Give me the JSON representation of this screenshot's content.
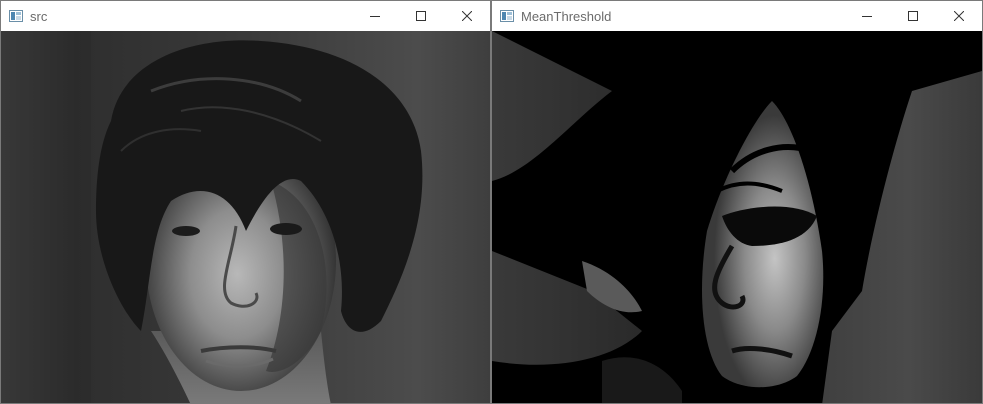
{
  "windows": [
    {
      "title": "src",
      "icon": "opencv-window-icon",
      "controls": {
        "minimize": "minimize-icon",
        "maximize": "maximize-icon",
        "close": "close-icon"
      },
      "image": {
        "description_icon": "portrait-photo",
        "mode": "grayscale"
      }
    },
    {
      "title": "MeanThreshold",
      "icon": "opencv-window-icon",
      "controls": {
        "minimize": "minimize-icon",
        "maximize": "maximize-icon",
        "close": "close-icon"
      },
      "image": {
        "description_icon": "portrait-photo",
        "mode": "thresholded"
      }
    }
  ],
  "colors": {
    "titlebar_bg": "#ffffff",
    "title_text": "#6b6b6b",
    "window_border": "#7a7a7a"
  }
}
